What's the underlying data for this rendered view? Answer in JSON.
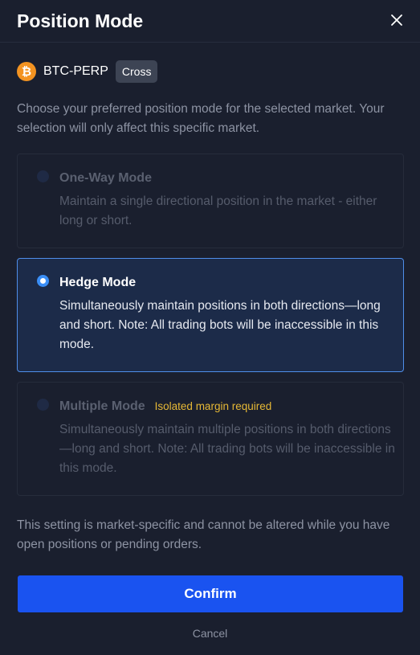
{
  "modal": {
    "title": "Position Mode",
    "close_icon": "close-icon"
  },
  "market": {
    "icon": "bitcoin-icon",
    "icon_color": "#f39321",
    "symbol": "BTC-PERP",
    "margin_badge": "Cross"
  },
  "description": "Choose your preferred position mode for the selected market. Your selection will only affect this specific market.",
  "options": [
    {
      "title": "One-Way Mode",
      "tag": "",
      "description": "Maintain a single directional position in the market - either long or short.",
      "selected": false,
      "disabled": true
    },
    {
      "title": "Hedge Mode",
      "tag": "",
      "description": "Simultaneously maintain positions in both directions—long and short. Note: All trading bots will be inaccessible in this mode.",
      "selected": true,
      "disabled": false
    },
    {
      "title": "Multiple Mode",
      "tag": "Isolated margin required",
      "description": "Simultaneously maintain multiple positions in both directions—long and short. Note: All trading bots will be inaccessible in this mode.",
      "selected": false,
      "disabled": true
    }
  ],
  "footnote": "This setting is market-specific and cannot be altered while you have open positions or pending orders.",
  "actions": {
    "confirm_label": "Confirm",
    "cancel_label": "Cancel"
  },
  "colors": {
    "background": "#1a1f2e",
    "accent": "#1a53f0",
    "selected_border": "#4f8ee9",
    "warning": "#e6b836"
  }
}
